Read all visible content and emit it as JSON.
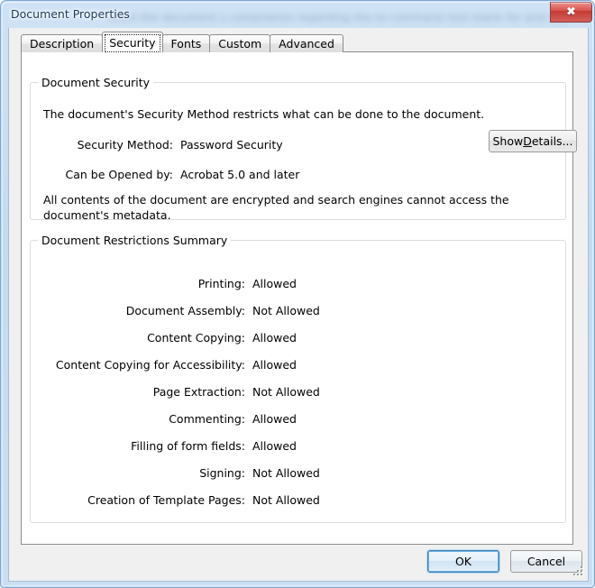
{
  "window": {
    "title": "Document Properties",
    "close_glyph": "✖",
    "close_label": "Close",
    "glass_bleed_text": "ment   the document   s compilation regarding the to command  text blank for  and use"
  },
  "tabs": [
    {
      "label": "Description",
      "active": false
    },
    {
      "label": "Security",
      "active": true
    },
    {
      "label": "Fonts",
      "active": false
    },
    {
      "label": "Custom",
      "active": false
    },
    {
      "label": "Advanced",
      "active": false
    }
  ],
  "document_security": {
    "group_title": "Document Security",
    "intro": "The document's Security Method restricts what can be done to the document.",
    "rows": [
      {
        "label": "Security Method:",
        "value": "Password Security"
      },
      {
        "label": "Can be Opened by:",
        "value": "Acrobat 5.0 and later"
      }
    ],
    "note": "All contents of the document are encrypted and search engines cannot access the document's metadata.",
    "show_details_prefix": "Show ",
    "show_details_accel": "D",
    "show_details_suffix": "etails..."
  },
  "restrictions": {
    "group_title": "Document Restrictions Summary",
    "rows": [
      {
        "label": "Printing:",
        "value": "Allowed"
      },
      {
        "label": "Document Assembly:",
        "value": "Not Allowed"
      },
      {
        "label": "Content Copying:",
        "value": "Allowed"
      },
      {
        "label": "Content Copying for Accessibility:",
        "value": "Allowed"
      },
      {
        "label": "Page Extraction:",
        "value": "Not Allowed"
      },
      {
        "label": "Commenting:",
        "value": "Allowed"
      },
      {
        "label": "Filling of form fields:",
        "value": "Allowed"
      },
      {
        "label": "Signing:",
        "value": "Not Allowed"
      },
      {
        "label": "Creation of Template Pages:",
        "value": "Not Allowed"
      }
    ]
  },
  "footer": {
    "ok_label": "OK",
    "cancel_label": "Cancel"
  },
  "colors": {
    "glass": "#c3dbf1",
    "frame_border": "#7ea6d4",
    "panel": "#ffffff",
    "client_bg": "#f0f0f0",
    "close_red": "#d9544e",
    "default_button_focus": "#3c7fb1",
    "group_border": "#d8dde2",
    "text": "#000000"
  }
}
